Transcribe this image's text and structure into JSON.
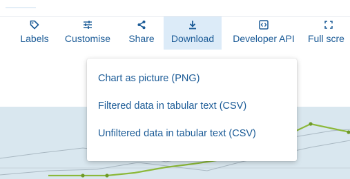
{
  "toolbar": {
    "items": [
      {
        "label": "Labels",
        "icon": "tag-icon"
      },
      {
        "label": "Customise",
        "icon": "sliders-icon"
      },
      {
        "label": "Share",
        "icon": "share-icon"
      },
      {
        "label": "Download",
        "icon": "download-icon",
        "active": true
      },
      {
        "label": "Developer API",
        "icon": "code-icon"
      },
      {
        "label": "Full scre",
        "icon": "fullscreen-icon"
      }
    ]
  },
  "download_menu": {
    "items": [
      {
        "label": "Chart as picture (PNG)"
      },
      {
        "label": "Filtered data in tabular text (CSV)"
      },
      {
        "label": "Unfiltered data in tabular text (CSV)"
      }
    ]
  },
  "colors": {
    "link_blue": "#1a5a96",
    "active_tab_bg": "#dcebf8",
    "chart_band": "#d9e7ef",
    "series_green": "#8cb83a",
    "series_grey": "#a9b8c2"
  }
}
